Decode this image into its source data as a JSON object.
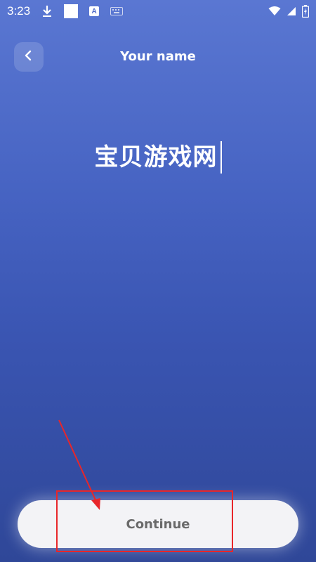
{
  "status_bar": {
    "time": "3:23",
    "icons": [
      "download-icon",
      "white-square",
      "a-icon",
      "keyboard-icon",
      "wifi-icon",
      "signal-icon",
      "battery-icon"
    ],
    "a_badge": "A"
  },
  "header": {
    "title": "Your name",
    "back_icon": "chevron-left-icon"
  },
  "name_input": {
    "value": "宝贝游戏网"
  },
  "continue_button": {
    "label": "Continue"
  },
  "colors": {
    "background_top": "#5a77d2",
    "background_bottom": "#2f4798",
    "button_bg": "#f3f3f6",
    "button_text": "#6a6a6a",
    "annotation": "#e8262a"
  }
}
